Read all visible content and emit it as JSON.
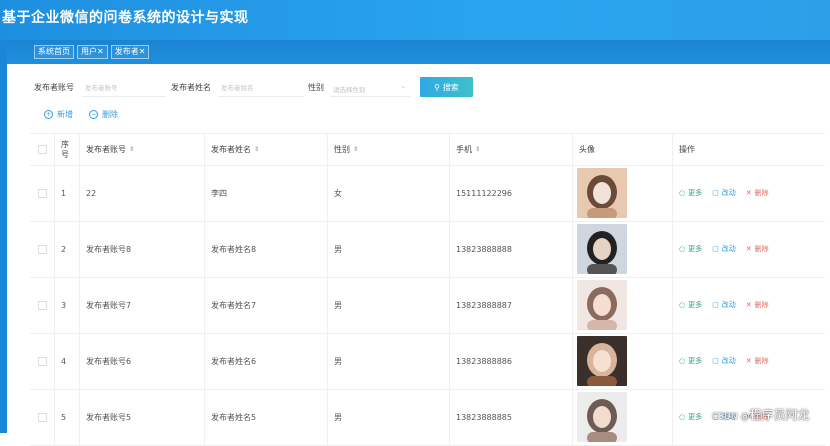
{
  "app": {
    "title": "基于企业微信的问卷系统的设计与实现"
  },
  "tabs": [
    {
      "label": "系统首页"
    },
    {
      "label": "用户✕"
    },
    {
      "label": "发布者✕"
    }
  ],
  "filters": {
    "account_label": "发布者账号",
    "account_placeholder": "发布者账号",
    "name_label": "发布者姓名",
    "name_placeholder": "发布者姓名",
    "gender_label": "性别",
    "gender_placeholder": "请选择性别",
    "search_label": "搜索"
  },
  "actions": {
    "add_label": "新增",
    "delete_label": "删除"
  },
  "table": {
    "headers": {
      "seq": "序号",
      "account": "发布者账号",
      "name": "发布者姓名",
      "gender": "性别",
      "phone": "手机",
      "avatar": "头像",
      "ops": "操作"
    },
    "op_labels": {
      "more": "更多",
      "edit": "改动",
      "remove": "删除"
    },
    "rows": [
      {
        "seq": "1",
        "account": "22",
        "name": "李四",
        "gender": "女",
        "phone": "15111122296"
      },
      {
        "seq": "2",
        "account": "发布者账号8",
        "name": "发布者姓名8",
        "gender": "男",
        "phone": "13823888888"
      },
      {
        "seq": "3",
        "account": "发布者账号7",
        "name": "发布者姓名7",
        "gender": "男",
        "phone": "13823888887"
      },
      {
        "seq": "4",
        "account": "发布者账号6",
        "name": "发布者姓名6",
        "gender": "男",
        "phone": "13823888886"
      },
      {
        "seq": "5",
        "account": "发布者账号5",
        "name": "发布者姓名5",
        "gender": "男",
        "phone": "13823888885"
      }
    ]
  },
  "watermark": {
    "prefix": "CSDN @",
    "text": "程序员阿龙"
  },
  "colors": {
    "header": "#1e8fe0",
    "accent": "#2b9ee8",
    "more": "#2aa67d",
    "remove": "#e06a64"
  }
}
